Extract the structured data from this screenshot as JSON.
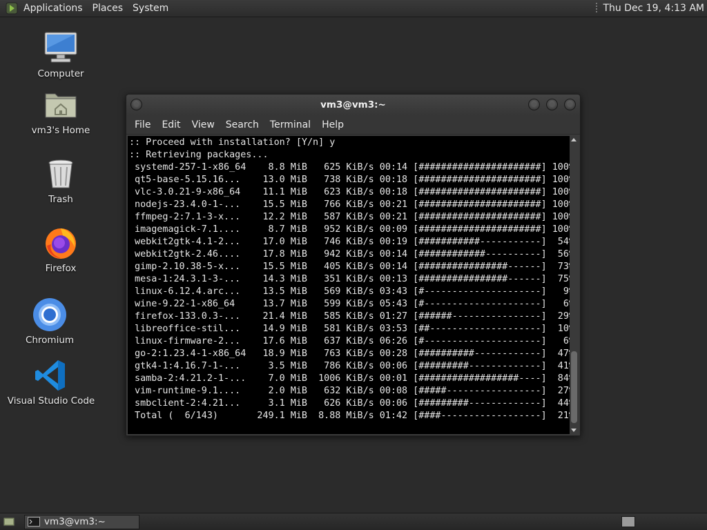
{
  "top_panel": {
    "menus": [
      "Applications",
      "Places",
      "System"
    ],
    "clock": "Thu Dec 19,  4:13 AM"
  },
  "desktop_icons": [
    {
      "label": "Computer",
      "icon": "computer-icon"
    },
    {
      "label": "vm3's Home",
      "icon": "home-folder-icon"
    },
    {
      "label": "Trash",
      "icon": "trash-icon"
    },
    {
      "label": "Firefox",
      "icon": "firefox-icon"
    },
    {
      "label": "Chromium",
      "icon": "chromium-icon"
    },
    {
      "label": "Visual Studio Code",
      "icon": "vscode-icon"
    }
  ],
  "terminal": {
    "title": "vm3@vm3:~",
    "menu": [
      "File",
      "Edit",
      "View",
      "Search",
      "Terminal",
      "Help"
    ],
    "lines": [
      ":: Proceed with installation? [Y/n] y",
      ":: Retrieving packages...",
      " systemd-257-1-x86_64    8.8 MiB   625 KiB/s 00:14 [######################] 100%",
      " qt5-base-5.15.16...    13.0 MiB   738 KiB/s 00:18 [######################] 100%",
      " vlc-3.0.21-9-x86_64    11.1 MiB   623 KiB/s 00:18 [######################] 100%",
      " nodejs-23.4.0-1-...    15.5 MiB   766 KiB/s 00:21 [######################] 100%",
      " ffmpeg-2:7.1-3-x...    12.2 MiB   587 KiB/s 00:21 [######################] 100%",
      " imagemagick-7.1....     8.7 MiB   952 KiB/s 00:09 [######################] 100%",
      " webkit2gtk-4.1-2...    17.0 MiB   746 KiB/s 00:19 [###########-----------]  54%",
      " webkit2gtk-2.46....    17.8 MiB   942 KiB/s 00:14 [############----------]  56%",
      " gimp-2.10.38-5-x...    15.5 MiB   405 KiB/s 00:14 [################------]  73%",
      " mesa-1:24.3.1-3-...    14.3 MiB   351 KiB/s 00:13 [################------]  75%",
      " linux-6.12.4.arc...    13.5 MiB   569 KiB/s 03:43 [#---------------------]   9%",
      " wine-9.22-1-x86_64     13.7 MiB   599 KiB/s 05:43 [#---------------------]   6%",
      " firefox-133.0.3-...    21.4 MiB   585 KiB/s 01:27 [######----------------]  29%",
      " libreoffice-stil...    14.9 MiB   581 KiB/s 03:53 [##--------------------]  10%",
      " linux-firmware-2...    17.6 MiB   637 KiB/s 06:26 [#---------------------]   6%",
      " go-2:1.23.4-1-x86_64   18.9 MiB   763 KiB/s 00:28 [##########------------]  47%",
      " gtk4-1:4.16.7-1-...     3.5 MiB   786 KiB/s 00:06 [#########-------------]  41%",
      " samba-2:4.21.2-1-...    7.0 MiB  1006 KiB/s 00:01 [##################----]  84%",
      " vim-runtime-9.1....     2.0 MiB   632 KiB/s 00:08 [#####-----------------]  27%",
      " smbclient-2:4.21...     3.1 MiB   626 KiB/s 00:06 [#########-------------]  44%",
      " Total (  6/143)       249.1 MiB  8.88 MiB/s 01:42 [####------------------]  21%"
    ]
  },
  "taskbar": {
    "window_title": "vm3@vm3:~"
  }
}
